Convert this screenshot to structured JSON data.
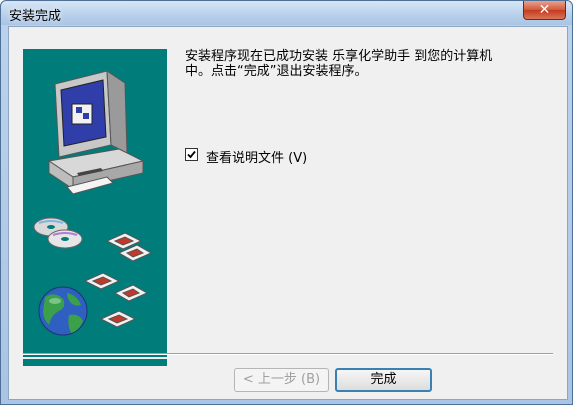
{
  "window": {
    "title": "安装完成",
    "close_symbol": "✕"
  },
  "panel": {
    "bg_color": "#007d7b",
    "icons": [
      "computer-icon",
      "cd-disc-icon",
      "floppy-disk-icon",
      "globe-icon"
    ]
  },
  "message": "安装程序现在已成功安装 乐享化学助手 到您的计算机\n中。点击“完成”退出安装程序。",
  "readme": {
    "label": "查看说明文件 (V)",
    "checked": true
  },
  "buttons": {
    "back_label": "< 上一步 (B)",
    "finish_label": "完成"
  }
}
